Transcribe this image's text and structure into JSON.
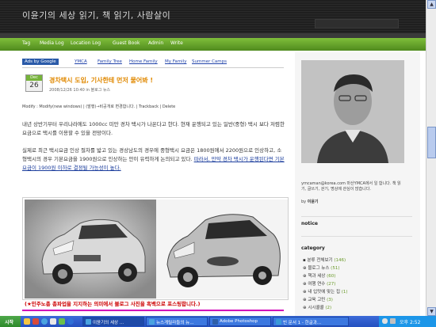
{
  "header": {
    "site_title": "이윤기의 세상 읽기, 책 읽기, 사람살이"
  },
  "nav": {
    "items": [
      "Tag",
      "Media Log",
      "Location Log",
      "Guest Book",
      "Admin",
      "Write"
    ]
  },
  "ads": {
    "label": "Ads by Google",
    "links": [
      "YMCA",
      "Family Tree",
      "Home Family",
      "My Family",
      "Summer Camps"
    ]
  },
  "post": {
    "date_month": "Dec",
    "date_day": "26",
    "title": "경차택시 도입, 기사한테 먼저 물어봐 !",
    "meta": "2008/12/26 10:40 in 블로그 뉴스",
    "modify_line": "Modify : Modify(new windows) | (발행)→비공개로 변경합니다. | Trackback | Delete",
    "para1": "내년 상반기부터 우리나라에도 1000cc 미만 경차 택시가 나온다고 한다. 현재 운행되고 있는 일반(중형) 택시 보다 저렴한 요금으로 택시를 이용할 수 있을 전망이다.",
    "para2_plain": "실제로 최근 택시요금 인상 절차를 밟고 있는 경상남도의 경우에 중형택시 요금은 1800원에서 2200원으로 인상하고, 소형택시의 경우 기본요금을 1900원으로 인상하는 안이 유력하게 논의되고 있다. ",
    "para2_link": "따라서, 만약 경차 택시가 운행된다면 기본요금이 1900원 이하로 결정될 가능성이 높다.",
    "protest_text": "(★민주노총 총파업을 지지하는 의미에서 블로그 사진을 흑백으로 포스팅합니다.)"
  },
  "sidebar": {
    "profile_text": "ymcaman@korea.com 마산YMCA에서 일 합니다. 책 읽기, 글쓰기, 걷기, 명상에 관심이 많습니다.",
    "profile_by_label": "by",
    "profile_by_name": "이윤기",
    "notice_heading": "notice",
    "category_heading": "category",
    "categories": [
      {
        "label": "분류 전체보기",
        "count": "(146)"
      },
      {
        "label": "블로그 뉴스",
        "count": "(51)"
      },
      {
        "label": "책과 세상",
        "count": "(60)"
      },
      {
        "label": "여행 연수",
        "count": "(27)"
      },
      {
        "label": "내 입맛에 맞는 집",
        "count": "(1)"
      },
      {
        "label": "교육 고민",
        "count": "(3)"
      },
      {
        "label": "시시콜콜",
        "count": "(2)"
      }
    ]
  },
  "taskbar": {
    "start_label": "시작",
    "buttons": [
      "이윤기의 세상 ...",
      "뉴스게릴라들의 뉴...",
      "Adobe Photoshop",
      "빈 문서 1 - 한글과..."
    ],
    "clock": "오후 2:52"
  },
  "colors": {
    "nav_green": "#6aa32b",
    "title_orange": "#e08800",
    "protest_red": "#cc0000",
    "link_blue": "#1a3c9c",
    "taskbar_blue": "#2350c0"
  }
}
